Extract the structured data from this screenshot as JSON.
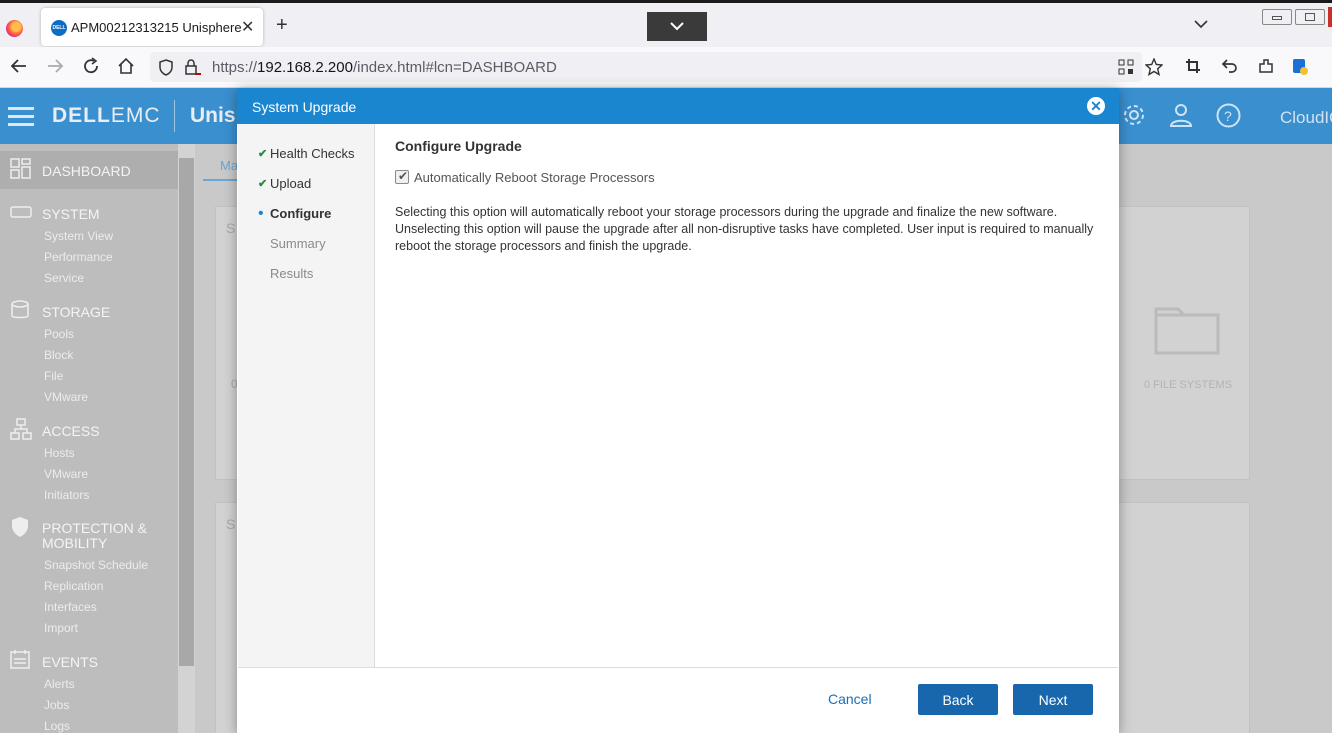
{
  "browser": {
    "tab_title": "APM00212313215 Unisphere",
    "tab_close": "✕",
    "new_tab": "+",
    "url_prefix": "https://",
    "url_host": "192.168.2.200",
    "url_path": "/index.html#lcn=DASHBOARD"
  },
  "app": {
    "brand_bold": "DELL",
    "brand_light": "EMC",
    "app_name": "Unisp",
    "cloudiq_label": "CloudIQ",
    "tab_fragment": "Ma"
  },
  "sidebar": {
    "dashboard": "DASHBOARD",
    "system": {
      "label": "SYSTEM",
      "items": [
        "System View",
        "Performance",
        "Service"
      ]
    },
    "storage": {
      "label": "STORAGE",
      "items": [
        "Pools",
        "Block",
        "File",
        "VMware"
      ]
    },
    "access": {
      "label": "ACCESS",
      "items": [
        "Hosts",
        "VMware",
        "Initiators"
      ]
    },
    "protection": {
      "label_line1": "PROTECTION &",
      "label_line2": "MOBILITY",
      "items": [
        "Snapshot Schedule",
        "Replication",
        "Interfaces",
        "Import"
      ]
    },
    "events": {
      "label": "EVENTS",
      "items": [
        "Alerts",
        "Jobs",
        "Logs"
      ]
    }
  },
  "dashboard": {
    "card1_letter": "S",
    "card2_letter": "S",
    "card1_value_fragment": "0",
    "file_systems_label": "0  FILE SYSTEMS"
  },
  "modal": {
    "title": "System Upgrade",
    "close": "✕",
    "steps": [
      {
        "label": "Health Checks",
        "state": "done"
      },
      {
        "label": "Upload",
        "state": "done"
      },
      {
        "label": "Configure",
        "state": "current"
      },
      {
        "label": "Summary",
        "state": "future"
      },
      {
        "label": "Results",
        "state": "future"
      }
    ],
    "step_done_mark": "✔",
    "step_current_mark": "•",
    "heading": "Configure Upgrade",
    "checkbox_label": "Automatically Reboot Storage Processors",
    "checkbox_checked": true,
    "checkbox_mark": "✔",
    "description": "Selecting this option will automatically reboot your storage processors during the upgrade and finalize the new software. Unselecting this option will pause the upgrade after all non-disruptive tasks have completed. User input is required to manually reboot the storage processors and finish the upgrade.",
    "cancel_label": "Cancel",
    "back_label": "Back",
    "next_label": "Next"
  },
  "colors": {
    "modal_header": "#1a86cf",
    "primary_button": "#1867ad",
    "check_green": "#2b8a3e"
  }
}
